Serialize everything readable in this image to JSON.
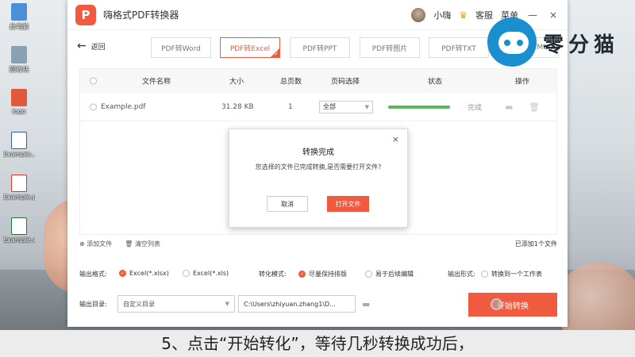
{
  "desktop": {
    "icons": [
      {
        "label": "此电脑",
        "icon": "computer-icon",
        "color": "#4a90d9"
      },
      {
        "label": "回收站",
        "icon": "recycle-bin-icon",
        "color": "#8aa0b5"
      },
      {
        "label": "logo",
        "icon": "image-file-icon",
        "color": "#e05a3a"
      },
      {
        "label": "Example...",
        "icon": "word-file-icon",
        "color": "#2b5fad"
      },
      {
        "label": "Example.pdf",
        "icon": "pdf-file-icon",
        "color": "#d93a2b"
      },
      {
        "label": "Example.xlsx",
        "icon": "excel-file-icon",
        "color": "#1f7a3e"
      }
    ]
  },
  "app": {
    "logo_text": "P",
    "title": "嗨格式PDF转换器",
    "user_name": "小嗨",
    "service": "客服",
    "menu": "菜单",
    "window_controls": {
      "minimize": "—",
      "close": "×"
    }
  },
  "toolbar": {
    "back_label": "返回",
    "tabs": [
      {
        "label": "PDF转Word",
        "active": false
      },
      {
        "label": "PDF转Excel",
        "active": true
      },
      {
        "label": "PDF转PPT",
        "active": false
      },
      {
        "label": "PDF转图片",
        "active": false
      },
      {
        "label": "PDF转TXT",
        "active": false
      },
      {
        "label": "TML",
        "active": false
      }
    ]
  },
  "table": {
    "headers": {
      "name": "文件名称",
      "size": "大小",
      "pages": "总页数",
      "range": "页码选择",
      "status": "状态",
      "ops": "操作"
    },
    "rows": [
      {
        "name": "Example.pdf",
        "size": "31.28 KB",
        "pages": "1",
        "range": "全部",
        "progress": 1.0,
        "status": "完成"
      }
    ]
  },
  "filebar": {
    "add_file": "添加文件",
    "clear_list": "清空列表",
    "count_text": "已添加1个文件"
  },
  "options": {
    "format_label": "输出格式:",
    "format_a": "Excel(*.xlsx)",
    "format_b": "Excel(*.xls)",
    "mode_label": "转化模式:",
    "mode_a": "尽量保持排版",
    "mode_b": "易于后续编辑",
    "shape_label": "输出形式:",
    "shape_a": "转换到一个工作表"
  },
  "output": {
    "dir_label": "输出目录:",
    "dir_option": "自定义目录",
    "path": "C:\\Users\\zhiyuan.zhang1\\D...",
    "start_button": "开始转换"
  },
  "dialog": {
    "title": "转换完成",
    "message": "您选择的文件已完成转换,是否需要打开文件?",
    "cancel": "取消",
    "open": "打开文件",
    "close": "×"
  },
  "watermark": {
    "text": "零分猫"
  },
  "subtitle": "5、点击“开始转化”，等待几秒转换成功后，",
  "colors": {
    "accent": "#f05a3e",
    "progress": "#5bb75b"
  }
}
